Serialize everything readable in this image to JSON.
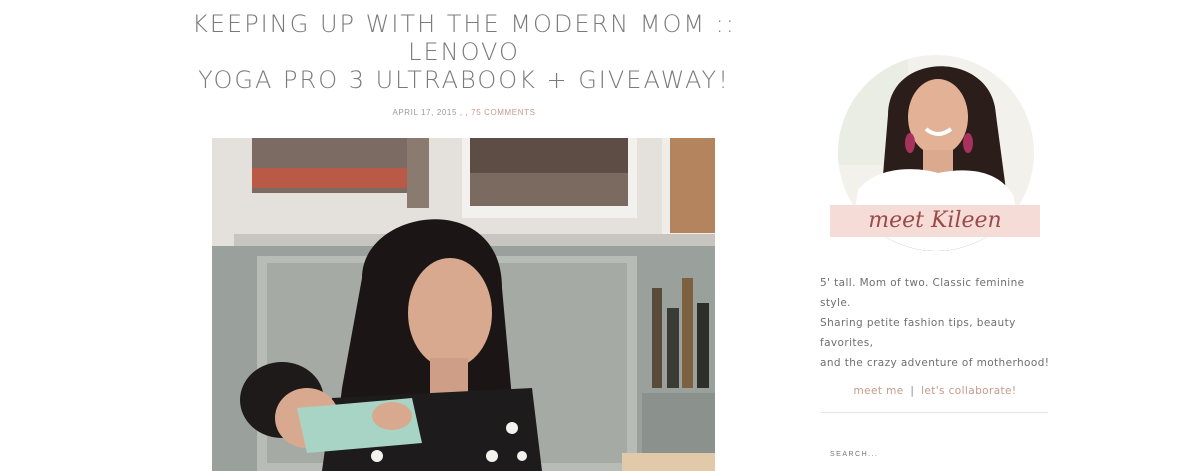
{
  "post": {
    "title_line1": "KEEPING UP WITH THE MODERN MOM :: LENOVO",
    "title_line2": "YOGA PRO 3 ULTRABOOK + GIVEAWAY!",
    "date": "APRIL 17, 2015",
    "meta_separator": ", ,",
    "comments_label": "75 COMMENTS",
    "featured_image_icon": "photo-mother-with-newborn-at-laptop"
  },
  "sidebar": {
    "avatar_icon": "author-portrait",
    "meet_label": "meet Kileen",
    "bio": {
      "line1": "5' tall. Mom of two. Classic feminine style.",
      "line2": "Sharing petite fashion tips, beauty favorites,",
      "line3": "and the crazy adventure of motherhood!"
    },
    "links": {
      "meet_me": "meet me",
      "separator": "|",
      "collaborate": "let's collaborate!"
    },
    "search": {
      "placeholder": "SEARCH..."
    }
  },
  "colors": {
    "accent": "#c79a8c",
    "title": "#7a7a7a",
    "banner": "#f6dcd6",
    "banner_text": "#9b4a4a"
  }
}
